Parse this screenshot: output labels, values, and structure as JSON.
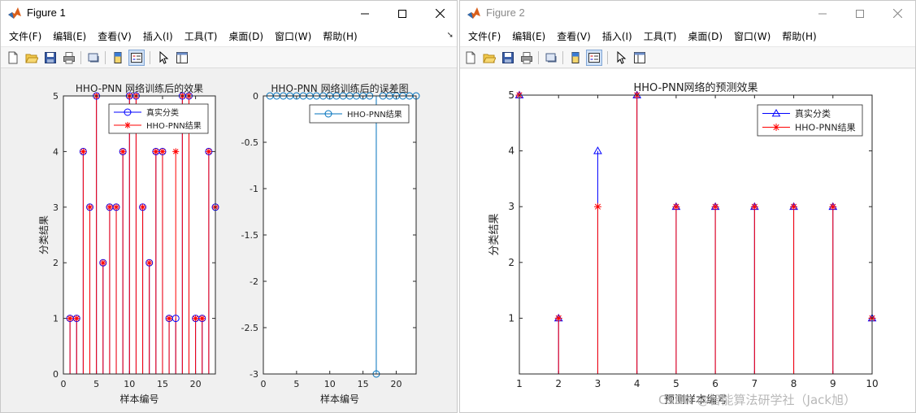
{
  "figure1": {
    "title": "Figure 1",
    "menu": [
      "文件(F)",
      "编辑(E)",
      "查看(V)",
      "插入(I)",
      "工具(T)",
      "桌面(D)",
      "窗口(W)",
      "帮助(H)"
    ],
    "toolbar_icons": [
      "new-file-icon",
      "open-folder-icon",
      "save-icon",
      "print-icon",
      "link-icon",
      "insert-colorbar-icon",
      "insert-legend-icon",
      "edit-pointer-icon",
      "property-editor-icon"
    ],
    "chart_data": [
      {
        "type": "stem",
        "title": "HHO-PNN 网络训练后的效果",
        "xlabel": "样本编号",
        "ylabel": "分类结果",
        "xlim": [
          0,
          23
        ],
        "ylim": [
          0,
          5
        ],
        "xticks": [
          0,
          5,
          10,
          15,
          20
        ],
        "yticks": [
          0,
          1,
          2,
          3,
          4,
          5
        ],
        "x": [
          1,
          2,
          3,
          4,
          5,
          6,
          7,
          8,
          9,
          10,
          11,
          12,
          13,
          14,
          15,
          16,
          17,
          18,
          19,
          20,
          21,
          22,
          23
        ],
        "legend_position": "top-right",
        "series": [
          {
            "name": "真实分类",
            "color": "#0000ff",
            "marker": "o",
            "values": [
              1,
              1,
              4,
              3,
              5,
              2,
              3,
              3,
              4,
              5,
              5,
              3,
              2,
              4,
              4,
              1,
              1,
              5,
              5,
              1,
              1,
              4,
              3
            ]
          },
          {
            "name": "HHO-PNN结果",
            "color": "#ff0000",
            "marker": "*",
            "values": [
              1,
              1,
              4,
              3,
              5,
              2,
              3,
              3,
              4,
              5,
              5,
              3,
              2,
              4,
              4,
              1,
              4,
              5,
              5,
              1,
              1,
              4,
              3
            ]
          }
        ]
      },
      {
        "type": "stem",
        "title": "HHO-PNN 网络训练后的误差图",
        "xlabel": "样本编号",
        "ylabel": "",
        "xlim": [
          0,
          23
        ],
        "ylim": [
          -3,
          0
        ],
        "xticks": [
          0,
          5,
          10,
          15,
          20
        ],
        "yticks": [
          0,
          -0.5,
          -1,
          -1.5,
          -2,
          -2.5,
          -3
        ],
        "x": [
          1,
          2,
          3,
          4,
          5,
          6,
          7,
          8,
          9,
          10,
          11,
          12,
          13,
          14,
          15,
          16,
          17,
          18,
          19,
          20,
          21,
          22,
          23
        ],
        "legend_position": "top-right",
        "series": [
          {
            "name": "HHO-PNN结果",
            "color": "#0072bd",
            "marker": "o",
            "values": [
              0,
              0,
              0,
              0,
              0,
              0,
              0,
              0,
              0,
              0,
              0,
              0,
              0,
              0,
              0,
              0,
              -3,
              0,
              0,
              0,
              0,
              0,
              0
            ]
          }
        ]
      }
    ]
  },
  "figure2": {
    "title": "Figure 2",
    "menu": [
      "文件(F)",
      "编辑(E)",
      "查看(V)",
      "插入(I)",
      "工具(T)",
      "桌面(D)",
      "窗口(W)",
      "帮助(H)"
    ],
    "toolbar_icons": [
      "new-file-icon",
      "open-folder-icon",
      "save-icon",
      "print-icon",
      "link-icon",
      "insert-colorbar-icon",
      "insert-legend-icon",
      "edit-pointer-icon",
      "property-editor-icon"
    ],
    "chart_data": {
      "type": "stem",
      "title": "HHO-PNN网络的预测效果",
      "xlabel": "预测样本编号",
      "ylabel": "分类结果",
      "xlim": [
        1,
        10
      ],
      "ylim": [
        0,
        5
      ],
      "xticks": [
        1,
        2,
        3,
        4,
        5,
        6,
        7,
        8,
        9,
        10
      ],
      "yticks": [
        1,
        2,
        3,
        4,
        5
      ],
      "x": [
        1,
        2,
        3,
        4,
        5,
        6,
        7,
        8,
        9,
        10
      ],
      "legend_position": "top-right",
      "series": [
        {
          "name": "真实分类",
          "color": "#0000ff",
          "marker": "^",
          "values": [
            5,
            1,
            4,
            5,
            3,
            3,
            3,
            3,
            3,
            1
          ]
        },
        {
          "name": "HHO-PNN结果",
          "color": "#ff0000",
          "marker": "*",
          "values": [
            5,
            1,
            3,
            5,
            3,
            3,
            3,
            3,
            3,
            1
          ]
        }
      ]
    }
  },
  "watermark": "CSDN @智能算法研学社（Jack旭）"
}
